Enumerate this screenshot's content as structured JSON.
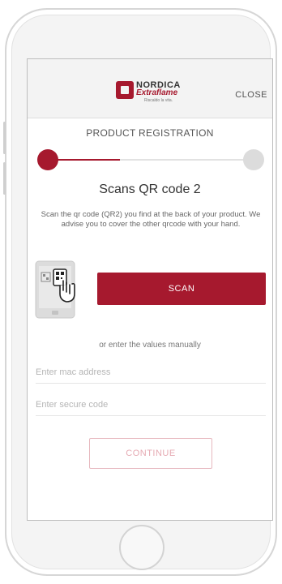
{
  "header": {
    "logo_top": "NORDICA",
    "logo_bottom": "Extraflame",
    "logo_tagline": "Riscaldo la vita.",
    "close_label": "CLOSE"
  },
  "page": {
    "title": "PRODUCT REGISTRATION",
    "progress_fraction": 0.35,
    "step_title": "Scans QR code 2",
    "description": "Scan the qr code (QR2) you find at the back of your product. We advise you to cover the other qrcode with your hand."
  },
  "actions": {
    "scan_label": "SCAN",
    "or_text": "or enter the values manually",
    "continue_label": "CONTINUE"
  },
  "fields": {
    "mac_placeholder": "Enter mac address",
    "mac_value": "",
    "secure_placeholder": "Enter secure code",
    "secure_value": ""
  },
  "colors": {
    "accent": "#a6192e",
    "inactive_dot": "#dcdcdc",
    "continue_disabled": "#e6aab3"
  },
  "icons": {
    "illustration": "phone-qr-scan-hand-icon"
  }
}
